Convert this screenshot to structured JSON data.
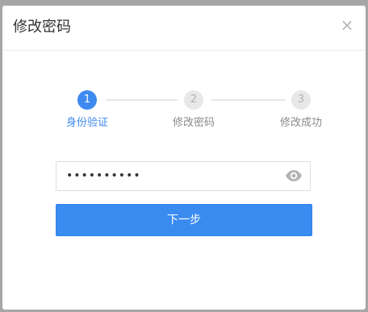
{
  "dialog": {
    "title": "修改密码",
    "close_symbol": "×"
  },
  "steps": [
    {
      "number": "1",
      "label": "身份验证",
      "state": "active"
    },
    {
      "number": "2",
      "label": "修改密码",
      "state": "inactive"
    },
    {
      "number": "3",
      "label": "修改成功",
      "state": "inactive"
    }
  ],
  "password_field": {
    "value": "••••••••••",
    "toggle_icon": "eye-icon"
  },
  "next_button": {
    "label": "下一步"
  },
  "colors": {
    "accent": "#3e8af0",
    "inactive_circle": "#e8e8e8",
    "inactive_text": "#8a8a8a"
  }
}
